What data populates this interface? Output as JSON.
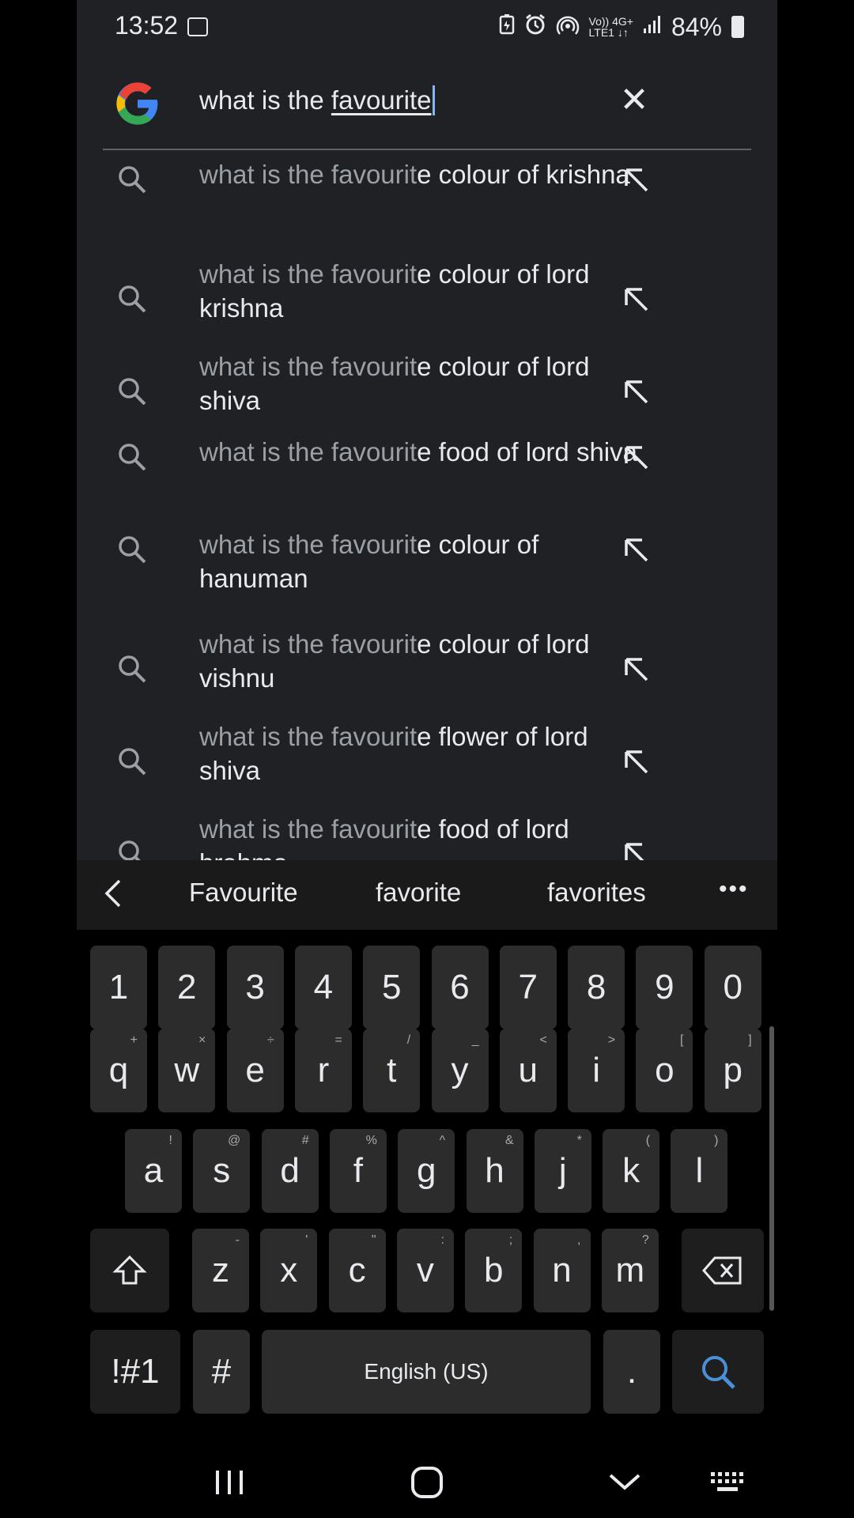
{
  "status_bar": {
    "time": "13:52",
    "network_top": "Vo)) 4G+",
    "network_bottom": "LTE1 ↓↑",
    "battery": "84%"
  },
  "search": {
    "query_prefix": "what is the ",
    "query_typed": "favourite"
  },
  "suggestions": [
    {
      "prefix": "what is the favourit",
      "rest": "e colour of krishna"
    },
    {
      "prefix": "what is the favourit",
      "rest": "e colour of lord krishna"
    },
    {
      "prefix": "what is the favourit",
      "rest": "e colour of lord shiva"
    },
    {
      "prefix": "what is the favourit",
      "rest": "e food of lord shiva"
    },
    {
      "prefix": "what is the favourit",
      "rest": "e colour of hanuman"
    },
    {
      "prefix": "what is the favourit",
      "rest": "e colour of lord vishnu"
    },
    {
      "prefix": "what is the favourit",
      "rest": "e flower of lord shiva"
    },
    {
      "prefix": "what is the favourit",
      "rest": "e food of lord brahma"
    }
  ],
  "keyboard": {
    "suggestions": [
      "Favourite",
      "favorite",
      "favorites"
    ],
    "more": "•••",
    "numbers": [
      "1",
      "2",
      "3",
      "4",
      "5",
      "6",
      "7",
      "8",
      "9",
      "0"
    ],
    "row1": [
      {
        "k": "q",
        "h": "+"
      },
      {
        "k": "w",
        "h": "×"
      },
      {
        "k": "e",
        "h": "÷"
      },
      {
        "k": "r",
        "h": "="
      },
      {
        "k": "t",
        "h": "/"
      },
      {
        "k": "y",
        "h": "_"
      },
      {
        "k": "u",
        "h": "<"
      },
      {
        "k": "i",
        "h": ">"
      },
      {
        "k": "o",
        "h": "["
      },
      {
        "k": "p",
        "h": "]"
      }
    ],
    "row2": [
      {
        "k": "a",
        "h": "!"
      },
      {
        "k": "s",
        "h": "@"
      },
      {
        "k": "d",
        "h": "#"
      },
      {
        "k": "f",
        "h": "%"
      },
      {
        "k": "g",
        "h": "^"
      },
      {
        "k": "h",
        "h": "&"
      },
      {
        "k": "j",
        "h": "*"
      },
      {
        "k": "k",
        "h": "("
      },
      {
        "k": "l",
        "h": ")"
      }
    ],
    "row3": [
      {
        "k": "z",
        "h": "-"
      },
      {
        "k": "x",
        "h": "'"
      },
      {
        "k": "c",
        "h": "\""
      },
      {
        "k": "v",
        "h": ":"
      },
      {
        "k": "b",
        "h": ";"
      },
      {
        "k": "n",
        "h": ","
      },
      {
        "k": "m",
        "h": "?"
      }
    ],
    "symbols_label": "!#1",
    "hash_label": "#",
    "space_label": "English (US)",
    "period_label": "."
  },
  "colors": {
    "background": "#202124",
    "accent": "#8ab4f8",
    "search_key": "#4a90d9"
  }
}
